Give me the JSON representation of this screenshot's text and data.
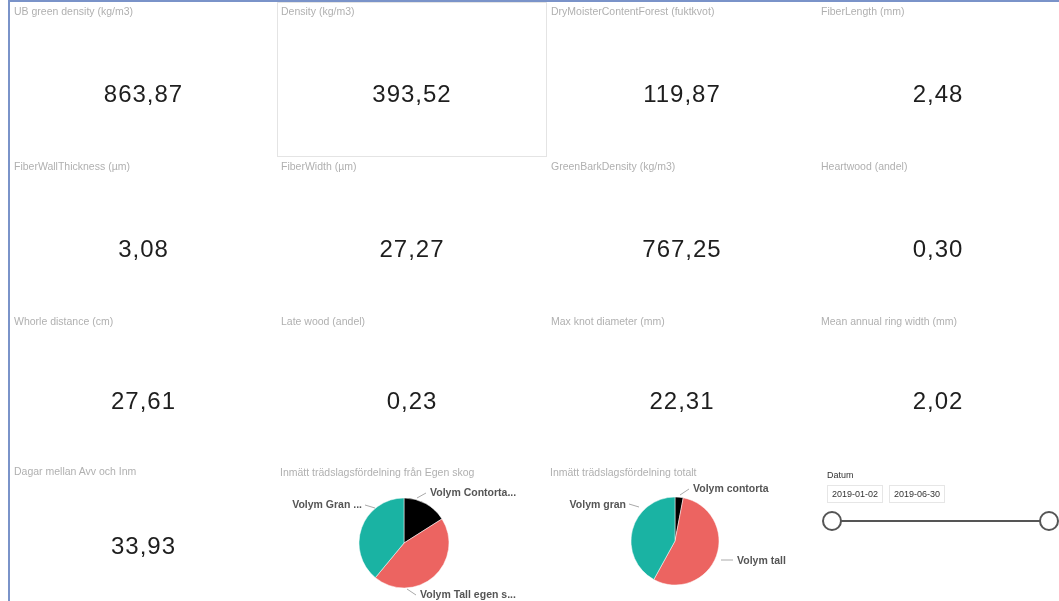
{
  "tiles": [
    {
      "kind": "card",
      "title": "UB green density (kg/m3)",
      "value": "863,87",
      "selected": false
    },
    {
      "kind": "card",
      "title": "Density (kg/m3)",
      "value": "393,52",
      "selected": true
    },
    {
      "kind": "card",
      "title": "DryMoisterContentForest (fuktkvot)",
      "value": "119,87",
      "selected": false
    },
    {
      "kind": "card",
      "title": "FiberLength (mm)",
      "value": "2,48",
      "selected": false
    },
    {
      "kind": "card",
      "title": "FiberWallThickness (µm)",
      "value": "3,08",
      "selected": false
    },
    {
      "kind": "card",
      "title": "FiberWidth (µm)",
      "value": "27,27",
      "selected": false
    },
    {
      "kind": "card",
      "title": "GreenBarkDensity (kg/m3)",
      "value": "767,25",
      "selected": false
    },
    {
      "kind": "card",
      "title": "Heartwood (andel)",
      "value": "0,30",
      "selected": false
    },
    {
      "kind": "card",
      "title": "Whorle distance (cm)",
      "value": "27,61",
      "selected": false
    },
    {
      "kind": "card",
      "title": "Late wood (andel)",
      "value": "0,23",
      "selected": false
    },
    {
      "kind": "card",
      "title": "Max knot diameter (mm)",
      "value": "22,31",
      "selected": false
    },
    {
      "kind": "card",
      "title": "Mean annual ring width (mm)",
      "value": "2,02",
      "selected": false
    },
    {
      "kind": "card",
      "title": "Dagar mellan Avv och Inm",
      "value": "33,93",
      "selected": false
    },
    {
      "kind": "pie",
      "title": "Inmätt trädslagsfördelning från Egen skog",
      "slices": [
        {
          "label": "Volym Contorta...",
          "color": "#000000"
        },
        {
          "label": "Volym Tall egen s...",
          "color": "#ec6461"
        },
        {
          "label": "Volym Gran ...",
          "color": "#1ab3a3"
        }
      ]
    },
    {
      "kind": "pie",
      "title": "Inmätt trädslagsfördelning totalt",
      "slices": [
        {
          "label": "Volym contorta",
          "color": "#000000"
        },
        {
          "label": "Volym tall",
          "color": "#ec6461"
        },
        {
          "label": "Volym gran",
          "color": "#1ab3a3"
        }
      ]
    },
    {
      "kind": "slicer",
      "title": "Datum",
      "start": "2019-01-02",
      "end": "2019-06-30",
      "handles": [
        {
          "level": 0
        },
        {
          "level": 1
        }
      ]
    }
  ]
}
